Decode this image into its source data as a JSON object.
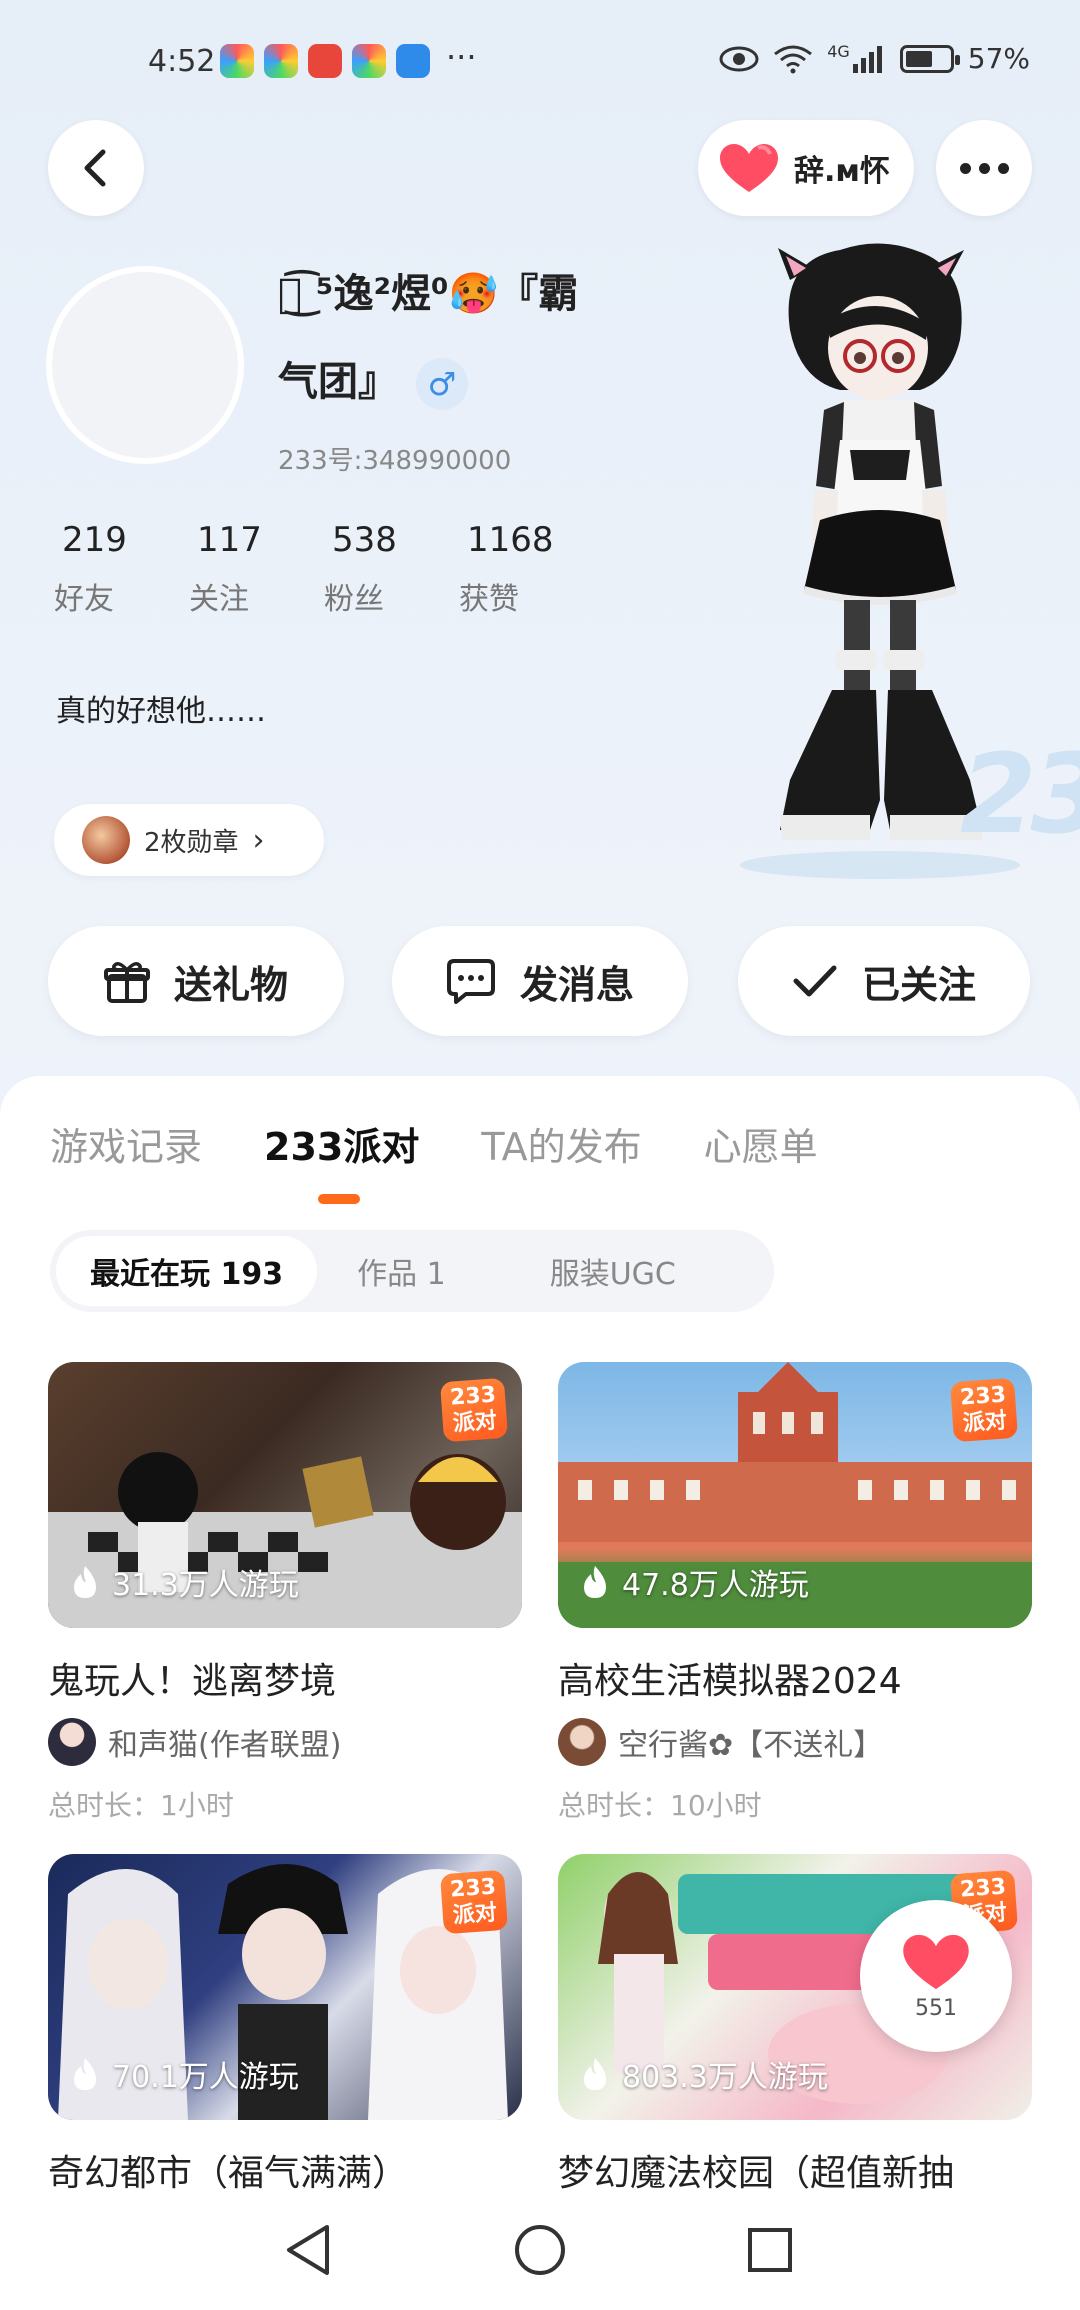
{
  "status_bar": {
    "time": "4:52",
    "network": "4G",
    "battery": "57%"
  },
  "header": {
    "friend_name": "辞.м怀"
  },
  "profile": {
    "nickname_line1": "ঌ͜͡ ⁵逸²煜⁰🥵『霸",
    "nickname_line2": "气团』",
    "gender": "♂",
    "uid": "233号:348990000",
    "stats": [
      {
        "num": "219",
        "label": "好友"
      },
      {
        "num": "117",
        "label": "关注"
      },
      {
        "num": "538",
        "label": "粉丝"
      },
      {
        "num": "1168",
        "label": "获赞"
      }
    ],
    "bio": "真的好想他……",
    "badges": "2枚勋章"
  },
  "actions": {
    "gift": "送礼物",
    "message": "发消息",
    "follow": "已关注"
  },
  "tabs": [
    "游戏记录",
    "233派对",
    "TA的发布",
    "心愿单"
  ],
  "subtabs": [
    "最近在玩 193",
    "作品 1",
    "服装UGC"
  ],
  "games": [
    {
      "title": "鬼玩人！逃离梦境",
      "plays": "31.3万人游玩",
      "author": "和声猫(作者联盟)",
      "duration": "总时长：1小时"
    },
    {
      "title": "高校生活模拟器2024",
      "plays": "47.8万人游玩",
      "author": "空行酱✿【不送礼】",
      "duration": "总时长：10小时"
    },
    {
      "title": "奇幻都市（福气满满）",
      "plays": "70.1万人游玩"
    },
    {
      "title": "梦幻魔法校园（超值新抽",
      "plays": "803.3万人游玩"
    }
  ],
  "tag": {
    "line1": "233",
    "line2": "派对"
  },
  "float_like_count": "551",
  "colors": {
    "accent": "#ff6a1a",
    "like": "#ff4d63"
  }
}
